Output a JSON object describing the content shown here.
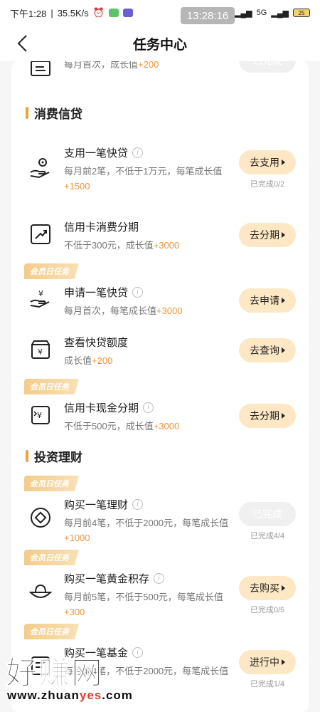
{
  "status_bar": {
    "time": "下午1:28",
    "speed": "35.5K/s",
    "clock_overlay": "13:28:16",
    "network": "5G",
    "battery": "25"
  },
  "nav": {
    "title": "任务中心"
  },
  "top_partial": {
    "desc": "每月首次，成长值",
    "plus": "+200",
    "button": "已完成"
  },
  "sections": {
    "consumer_credit": "消费信贷",
    "investment": "投资理财"
  },
  "badge_label": "会员日任务",
  "tasks": [
    {
      "name": "支用一笔快贷",
      "desc": "每月前2笔，不低于1万元，每笔成长值",
      "plus": "+1500",
      "button": "去支用",
      "progress": "已完成0/2"
    },
    {
      "name": "信用卡消费分期",
      "desc": "不低于300元，成长值",
      "plus": "+3000",
      "button": "去分期",
      "progress": ""
    },
    {
      "name": "申请一笔快贷",
      "desc": "每月首次，每笔成长值",
      "plus": "+3000",
      "button": "去申请",
      "progress": ""
    },
    {
      "name": "查看快贷额度",
      "desc": "成长值",
      "plus": "+200",
      "button": "去查询",
      "progress": ""
    },
    {
      "name": "信用卡现金分期",
      "desc": "不低于500元，成长值",
      "plus": "+3000",
      "button": "去分期",
      "progress": ""
    },
    {
      "name": "购买一笔理财",
      "desc": "每月前4笔，不低于2000元，每笔成长值",
      "plus": "+1000",
      "button": "已完成",
      "progress": "已完成4/4"
    },
    {
      "name": "购买一笔黄金积存",
      "desc": "每月前5笔，不低于500元，每笔成长值",
      "plus": "+300",
      "button": "去购买",
      "progress": "已完成0/5"
    },
    {
      "name": "购买一笔基金",
      "desc": "每月前4笔，不低于2000元，每笔成长值",
      "plus": "",
      "button": "进行中",
      "progress": "已完成1/4"
    }
  ],
  "watermark": {
    "big": "好赚网",
    "url_pre": "www.zhuan",
    "url_red": "yes",
    "url_post": ".com"
  }
}
